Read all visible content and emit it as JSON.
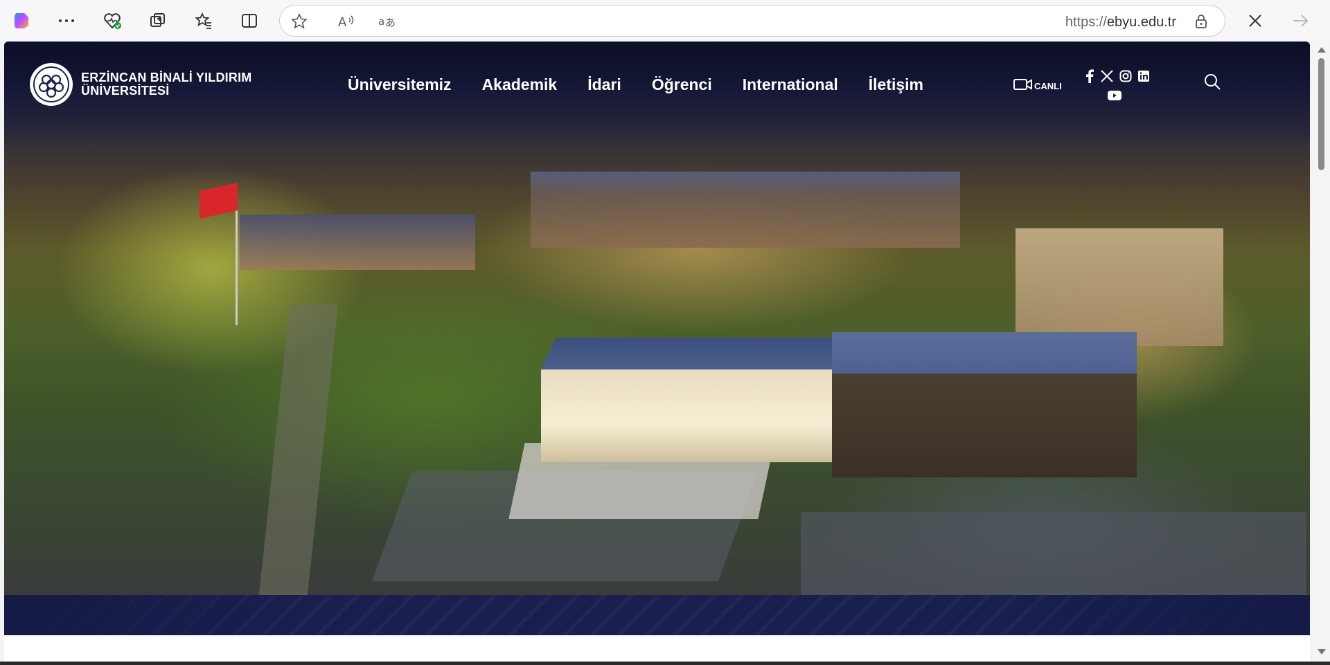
{
  "browser": {
    "url_prefix": "https://",
    "url_host": "ebyu.edu.tr",
    "icons": [
      "copilot-icon",
      "more-icon",
      "health-icon",
      "collections-icon",
      "favorites-icon",
      "split-screen-icon",
      "favorite-star-icon",
      "read-aloud-icon",
      "translate-icon",
      "lock-icon",
      "close-icon",
      "forward-icon"
    ]
  },
  "site": {
    "logo_line1": "ERZİNCAN BİNALİ YILDIRIM",
    "logo_line2": "ÜNİVERSİTESİ",
    "nav": [
      {
        "label": "Üniversitemiz"
      },
      {
        "label": "Akademik"
      },
      {
        "label": "İdari"
      },
      {
        "label": "Öğrenci"
      },
      {
        "label": "International"
      },
      {
        "label": "İletişim"
      }
    ],
    "live_label": "CANLI",
    "social": [
      "facebook-icon",
      "x-icon",
      "instagram-icon",
      "linkedin-icon",
      "youtube-icon"
    ]
  },
  "colors": {
    "band": "#1a2150",
    "flag": "#d8262b"
  }
}
